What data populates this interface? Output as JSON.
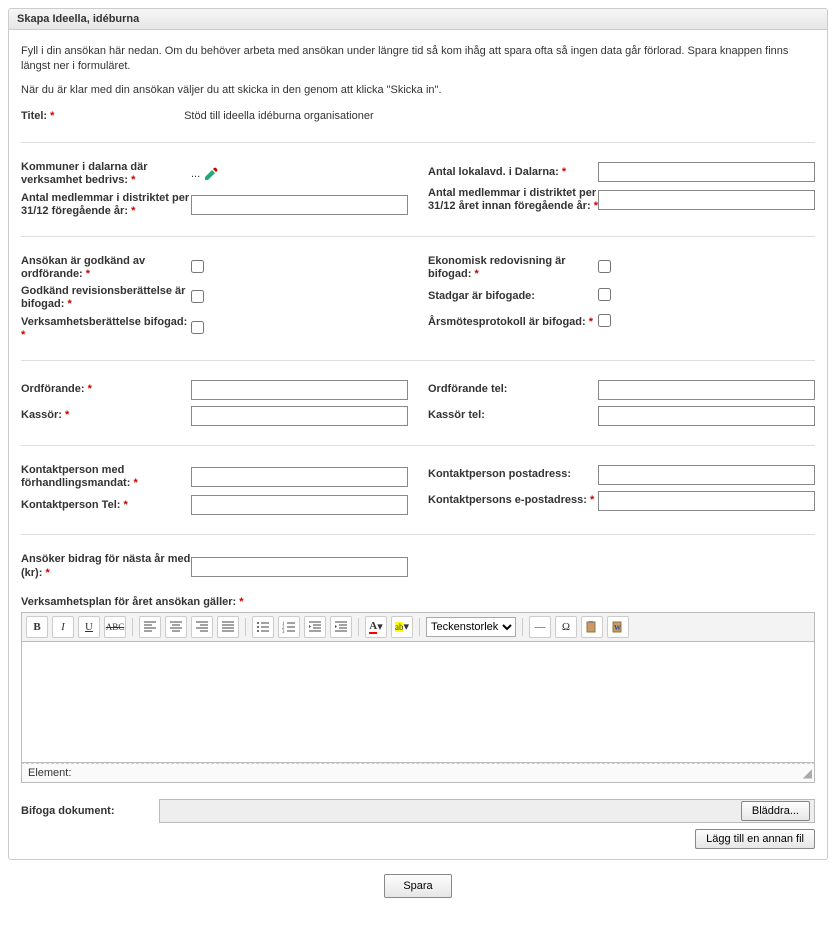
{
  "header": "Skapa Ideella, idéburna",
  "intro1": "Fyll i din ansökan här nedan. Om du behöver arbeta med ansökan under längre tid så kom ihåg att spara ofta så ingen data går förlorad. Spara knappen finns längst ner i formuläret.",
  "intro2": "När du är klar med din ansökan väljer du att skicka in den genom att klicka \"Skicka in\".",
  "title_label": "Titel:",
  "title_value": "Stöd till ideella idéburna organisationer",
  "asterisk": "*",
  "labels": {
    "kommuner": "Kommuner i dalarna där verksamhet bedrivs:",
    "antal_lokalavd": "Antal lokalavd. i Dalarna:",
    "antal_medl_fg": "Antal medlemmar i distriktet per 31/12 föregående år:",
    "antal_medl_innan": "Antal medlemmar i distriktet per 31/12 året innan föregående år:",
    "ansokan_godkand": "Ansökan är godkänd av ordförande:",
    "ekonomisk_redov": "Ekonomisk redovisning är bifogad:",
    "godkand_revision": "Godkänd revisionsberättelse är bifogad:",
    "stadgar": "Stadgar är bifogade:",
    "verksamhet": "Verksamhetsberättelse bifogad:",
    "arsmote": "Årsmötesprotokoll är bifogad:",
    "ordforande": "Ordförande:",
    "ordforande_tel": "Ordförande tel:",
    "kassor": "Kassör:",
    "kassor_tel": "Kassör tel:",
    "kontakt_mandat": "Kontaktperson med förhandlingsmandat:",
    "kontakt_post": "Kontaktperson postadress:",
    "kontakt_tel": "Kontaktperson Tel:",
    "kontakt_email": "Kontaktpersons e-postadress:",
    "ansoker_bidrag": "Ansöker bidrag för nästa år med (kr):",
    "verksamhetsplan": "Verksamhetsplan för året ansökan gäller:",
    "bifoga": "Bifoga dokument:"
  },
  "rte": {
    "fontsize_label": "Teckenstorlek",
    "element_label": "Element:"
  },
  "buttons": {
    "browse": "Bläddra...",
    "add_file": "Lägg till en annan fil",
    "save": "Spara"
  },
  "picker_dots": "..."
}
